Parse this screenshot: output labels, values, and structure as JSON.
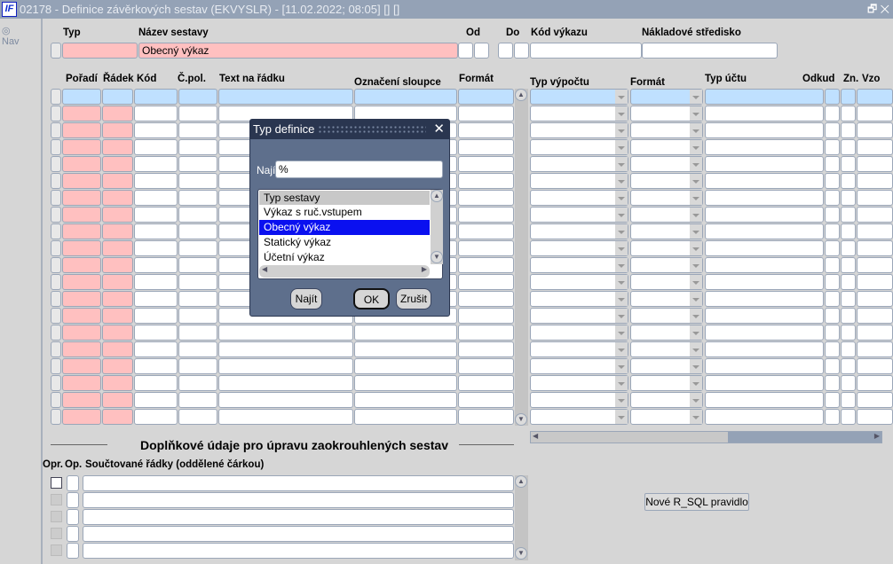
{
  "window": {
    "title": "02178 - Definice závěrkových sestav (EKVYSLR) - [11.02.2022; 08:05]  []  []",
    "logo": "IF",
    "buttons": "🗗 ✕"
  },
  "nav": {
    "label": "Nav"
  },
  "header": {
    "typ_label": "Typ",
    "nazev_label": "Název sestavy",
    "nazev_value": "Obecný výkaz",
    "od_label": "Od",
    "do_label": "Do",
    "kod_label": "Kód výkazu",
    "stredisko_label": "Nákladové středisko"
  },
  "left_grid": {
    "columns": [
      "Pořadí",
      "Řádek",
      "Kód",
      "Č.pol.",
      "Text na řádku",
      "Označení sloupce",
      "Formát"
    ],
    "rows": 20
  },
  "right_grid": {
    "columns": [
      "Typ výpočtu",
      "Formát",
      "Typ účtu",
      "Odkud",
      "Zn.",
      "Vzo"
    ],
    "rows": 20
  },
  "section": {
    "title": "Doplňkové údaje pro úpravu zaokrouhlených sestav",
    "columns": [
      "Opr.",
      "Op.",
      "Součtované řádky (oddělené čárkou)"
    ],
    "rows": 5
  },
  "rsql_button": "Nové R_SQL pravidlo",
  "dialog": {
    "title": "Typ definice",
    "find_label": "Najít",
    "find_value": "%",
    "list_header": "Typ sestavy",
    "items": [
      "Výkaz s ruč.vstupem",
      "Obecný výkaz",
      "Statický výkaz",
      "Účetní výkaz"
    ],
    "selected_index": 1,
    "find_button": "Najít",
    "ok_button": "OK",
    "cancel_button": "Zrušit"
  }
}
